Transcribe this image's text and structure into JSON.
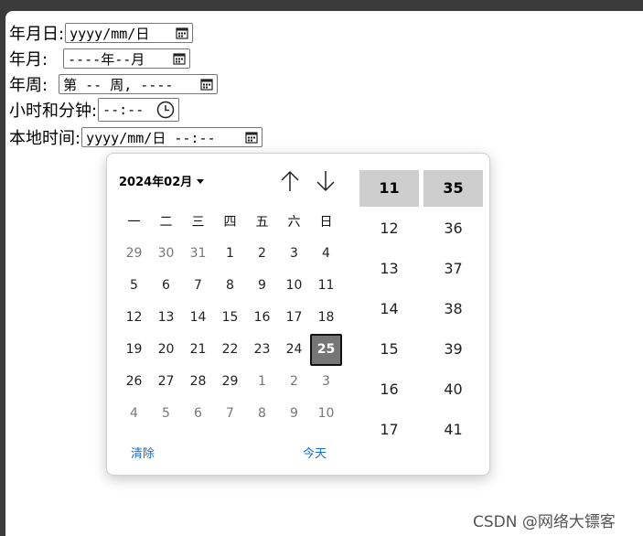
{
  "form": {
    "date_label": "年月日:",
    "date_value": "yyyy/mm/日",
    "month_label": "年月:",
    "month_value": "----年--月",
    "week_label": "年周:",
    "week_value": "第 -- 周, ----",
    "time_label": "小时和分钟:",
    "time_value": "--:--",
    "datetime_label": "本地时间:",
    "datetime_value": "yyyy/mm/日 --:--"
  },
  "picker": {
    "month_title": "2024年02月",
    "weekdays": [
      "一",
      "二",
      "三",
      "四",
      "五",
      "六",
      "日"
    ],
    "days": [
      [
        "29",
        "30",
        "31",
        "1",
        "2",
        "3",
        "4"
      ],
      [
        "5",
        "6",
        "7",
        "8",
        "9",
        "10",
        "11"
      ],
      [
        "12",
        "13",
        "14",
        "15",
        "16",
        "17",
        "18"
      ],
      [
        "19",
        "20",
        "21",
        "22",
        "23",
        "24",
        "25"
      ],
      [
        "26",
        "27",
        "28",
        "29",
        "1",
        "2",
        "3"
      ],
      [
        "4",
        "5",
        "6",
        "7",
        "8",
        "9",
        "10"
      ]
    ],
    "selected_day": "25",
    "hours": [
      "11",
      "12",
      "13",
      "14",
      "15",
      "16",
      "17"
    ],
    "minutes": [
      "35",
      "36",
      "37",
      "38",
      "39",
      "40",
      "41"
    ],
    "selected_hour": "11",
    "selected_minute": "35",
    "clear_label": "清除",
    "today_label": "今天"
  },
  "watermark": "CSDN @网络大镖客",
  "icons": {
    "calendar": "calendar-icon",
    "clock": "clock-icon",
    "arrow_up": "arrow-up-icon",
    "arrow_down": "arrow-down-icon",
    "dropdown": "caret-down-icon"
  },
  "colors": {
    "selected_day_bg": "#767676",
    "selected_time_bg": "#cecece",
    "link": "#1a6dc8"
  }
}
